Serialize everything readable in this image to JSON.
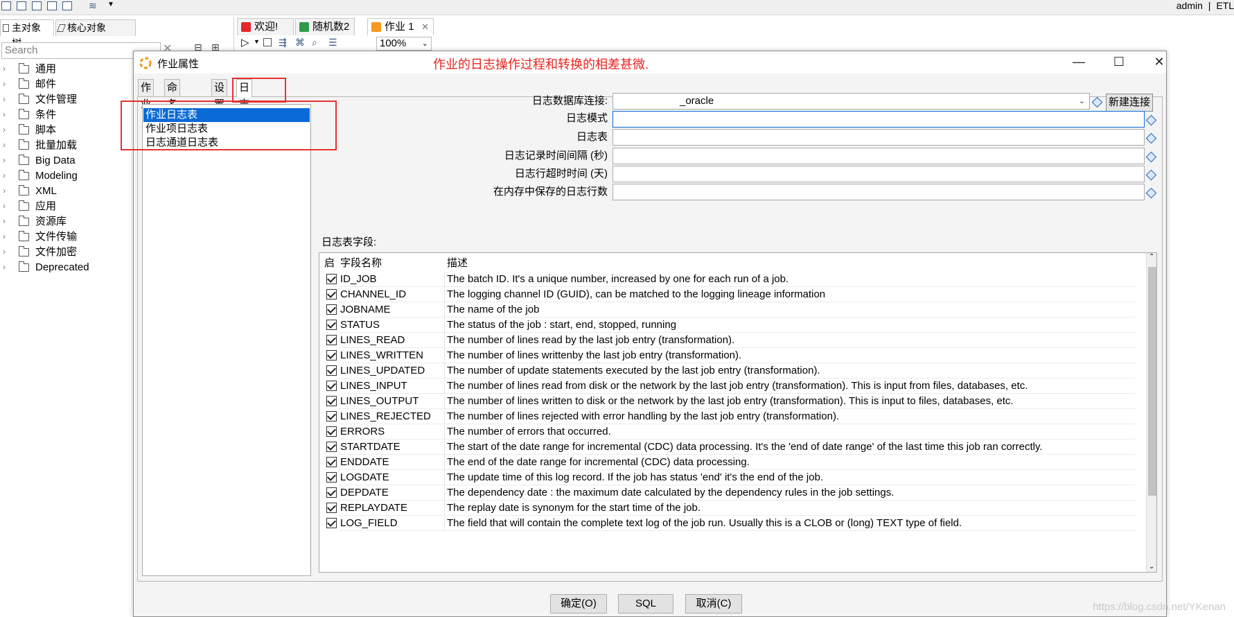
{
  "header": {
    "user": "admin",
    "separator": "|",
    "app_short": "ETL"
  },
  "left_panel": {
    "tabs": [
      {
        "label": "主对象树"
      },
      {
        "label": "核心对象"
      }
    ],
    "search_placeholder": "Search",
    "tree": [
      {
        "label": "通用"
      },
      {
        "label": "邮件"
      },
      {
        "label": "文件管理"
      },
      {
        "label": "条件"
      },
      {
        "label": "脚本"
      },
      {
        "label": "批量加载"
      },
      {
        "label": "Big Data"
      },
      {
        "label": "Modeling"
      },
      {
        "label": "XML"
      },
      {
        "label": "应用"
      },
      {
        "label": "资源库"
      },
      {
        "label": "文件传输"
      },
      {
        "label": "文件加密"
      },
      {
        "label": "Deprecated"
      }
    ]
  },
  "editor": {
    "tabs": [
      {
        "label": "欢迎!",
        "color": "#e3262b"
      },
      {
        "label": "随机数2",
        "color": "#2f9a4a"
      },
      {
        "label": "作业 1",
        "color": "#f39a1c",
        "close": "✕"
      }
    ],
    "zoom": "100%"
  },
  "dialog": {
    "title": "作业属性",
    "annotation_note": "作业的日志操作过程和转换的相差甚微.",
    "tabs": [
      {
        "label": "作业"
      },
      {
        "label": "命名参数"
      },
      {
        "label": "设置"
      },
      {
        "label": "日志"
      }
    ],
    "categories": [
      {
        "label": "作业日志表"
      },
      {
        "label": "作业项日志表"
      },
      {
        "label": "日志通道日志表"
      }
    ],
    "form": {
      "db_conn_label": "日志数据库连接:",
      "db_conn_value": "_oracle",
      "new_conn_button": "新建连接",
      "schema_label": "日志模式",
      "table_label": "日志表",
      "interval_label": "日志记录时间间隔 (秒)",
      "timeout_label": "日志行超时时间 (天)",
      "max_lines_label": "在内存中保存的日志行数"
    },
    "fields_label": "日志表字段:",
    "table": {
      "columns": {
        "enabled": "启",
        "name": "字段名称",
        "desc": "描述"
      },
      "rows": [
        {
          "name": "ID_JOB",
          "desc": "The batch ID. It's a unique number, increased by one for each run of a job."
        },
        {
          "name": "CHANNEL_ID",
          "desc": "The logging channel ID (GUID), can be matched to the logging lineage information"
        },
        {
          "name": "JOBNAME",
          "desc": "The name of the job"
        },
        {
          "name": "STATUS",
          "desc": "The status of the job : start, end, stopped, running"
        },
        {
          "name": "LINES_READ",
          "desc": "The number of lines read by the last job entry (transformation)."
        },
        {
          "name": "LINES_WRITTEN",
          "desc": "The number of lines writtenby the last job entry (transformation)."
        },
        {
          "name": "LINES_UPDATED",
          "desc": "The number of update statements executed by the last job entry (transformation)."
        },
        {
          "name": "LINES_INPUT",
          "desc": "The number of lines read from disk or the network by the last job entry (transformation). This is input from files, databases, etc."
        },
        {
          "name": "LINES_OUTPUT",
          "desc": "The number of lines written to disk or the network by the last job entry (transformation). This is input to files, databases, etc."
        },
        {
          "name": "LINES_REJECTED",
          "desc": "The number of lines rejected with error handling by the last job entry (transformation)."
        },
        {
          "name": "ERRORS",
          "desc": "The number of errors that occurred."
        },
        {
          "name": "STARTDATE",
          "desc": "The start of the date range for incremental (CDC) data processing. It's the 'end of date range' of the last time this job ran correctly."
        },
        {
          "name": "ENDDATE",
          "desc": "The end of the date range for incremental (CDC) data processing."
        },
        {
          "name": "LOGDATE",
          "desc": "The update time of this log record.  If the job has status 'end' it's the end of the job."
        },
        {
          "name": "DEPDATE",
          "desc": "The dependency date : the maximum date calculated by the dependency rules in the job settings."
        },
        {
          "name": "REPLAYDATE",
          "desc": "The replay date is synonym for the start time of the job."
        },
        {
          "name": "LOG_FIELD",
          "desc": "The field that will contain the complete text log of the job run.  Usually this is a CLOB or (long) TEXT type of field."
        }
      ]
    },
    "buttons": {
      "ok": "确定(O)",
      "sql": "SQL",
      "cancel": "取消(C)"
    }
  },
  "watermark": "https://blog.csdn.net/YKenan",
  "colors": {
    "selection": "#0a6ad6",
    "annotation_red": "#ea2f2f",
    "note_red": "#e8231f"
  }
}
